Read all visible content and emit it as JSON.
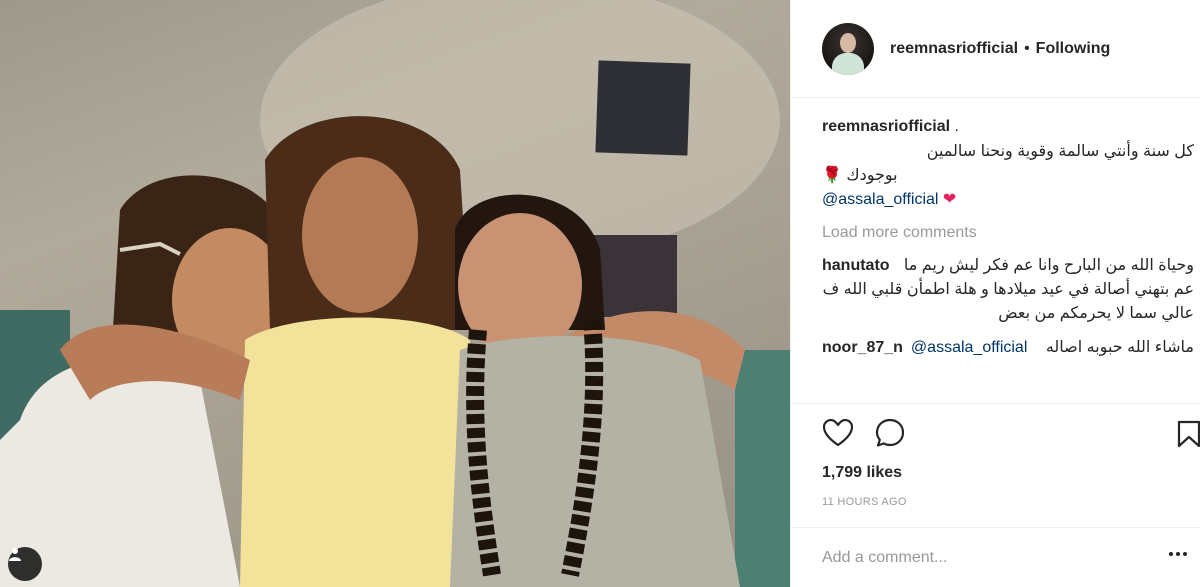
{
  "post": {
    "username": "reemnasriofficial",
    "follow_status": "Following",
    "separator": "•"
  },
  "caption": {
    "username": "reemnasriofficial",
    "trailing": ".",
    "line1": "كل سنة وأنتي سالمة وقوية ونحنا سالمين",
    "line2": "بوجودك",
    "line2_emoji": "🌹",
    "mention": "@assala_official",
    "heart": "❤"
  },
  "load_more_label": "Load more comments",
  "comments": [
    {
      "username": "hanutato",
      "text": "وحياة الله من البارح وانا عم فكر ليش ريم ما عم بتهني أصالة في عيد ميلادها و هلة اطمأن قلبي الله ف عالي سما لا يحرمكم من بعض"
    },
    {
      "username": "noor_87_n",
      "mention": "@assala_official",
      "text": "ماشاء الله حبوبه اصاله"
    }
  ],
  "likes": "1,799 likes",
  "timestamp": "11 HOURS AGO",
  "add_comment_placeholder": "Add a comment...",
  "icons": {
    "like": "heart-outline-icon",
    "comment": "comment-bubble-icon",
    "save": "bookmark-icon",
    "tag": "person-tag-icon",
    "more": "more-options-icon"
  },
  "colors": {
    "text": "#262626",
    "muted": "#999999",
    "link": "#003569",
    "divider": "#efefef"
  }
}
